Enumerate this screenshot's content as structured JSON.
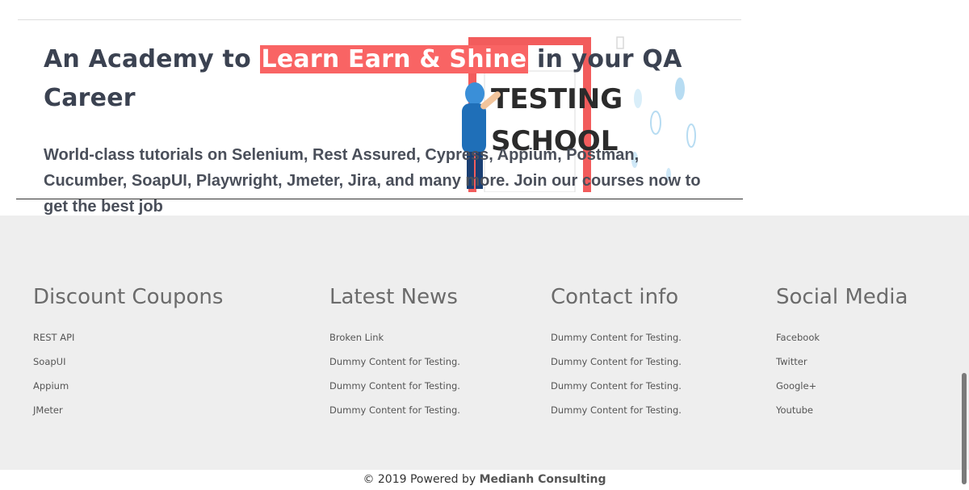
{
  "hero": {
    "title_part1": "An Academy to ",
    "title_highlight": "Learn Earn & Shine",
    "title_part2": "  in your QA Career",
    "description": "World-class tutorials on Selenium, Rest Assured, Cypress, Appium, Postman, Cucumber, SoapUI, Playwright, Jmeter, Jira, and many more. Join our courses now to get the best job",
    "graphic_line1": "TESTING",
    "graphic_line2": "SCHOOL",
    "highlight_color": "#f96464"
  },
  "footer": {
    "columns": [
      {
        "heading": "Discount Coupons",
        "links": [
          "REST API",
          "SoapUI",
          "Appium",
          "JMeter"
        ]
      },
      {
        "heading": "Latest News",
        "links": [
          "Broken Link",
          "Dummy Content for Testing.",
          "Dummy Content for Testing.",
          "Dummy Content for Testing."
        ]
      },
      {
        "heading": "Contact info",
        "links": [
          "Dummy Content for Testing.",
          "Dummy Content for Testing.",
          "Dummy Content for Testing.",
          "Dummy Content for Testing."
        ]
      },
      {
        "heading": "Social Media",
        "links": [
          "Facebook",
          "Twitter",
          "Google+",
          "Youtube"
        ]
      }
    ]
  },
  "copyright": {
    "prefix": "© 2019 Powered by ",
    "brand": "Medianh Consulting"
  }
}
